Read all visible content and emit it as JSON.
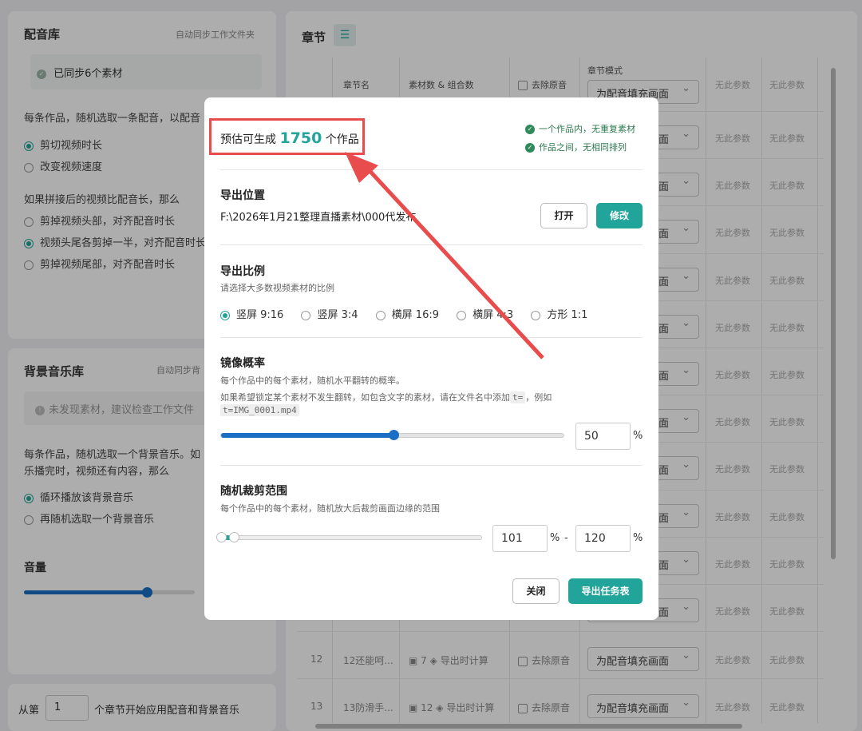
{
  "dubbing_library": {
    "title": "配音库",
    "auto_sync": "自动同步工作文件夹",
    "sync_status": "已同步6个素材",
    "desc": "每条作品，随机选取一条配音，以配音",
    "options_a": [
      "剪切视频时长",
      "改变视频速度"
    ],
    "if_longer": "如果拼接后的视频比配音长，那么",
    "options_b": [
      "剪掉视频头部，对齐配音时长",
      "视频头尾各剪掉一半，对齐配音时长",
      "剪掉视频尾部，对齐配音时长"
    ]
  },
  "bgm_library": {
    "title": "背景音乐库",
    "auto_sync": "自动同步背",
    "status": "未发现素材，建议检查工作文件",
    "desc_line1": "每条作品，随机选取一个背景音乐。如",
    "desc_line2": "乐播完时，视频还有内容，那么",
    "options": [
      "循环播放该背景音乐",
      "再随机选取一个背景音乐"
    ],
    "volume_label": "音量",
    "volume_value": 0.72
  },
  "apply_from": {
    "prefix": "从第",
    "value": "1",
    "suffix": "个章节开始应用配音和背景音乐"
  },
  "chapters": {
    "title": "章节",
    "menu_icon": "list-icon",
    "headers": {
      "name": "章节名",
      "materials": "素材数 & 组合数",
      "remove_audio": "去除原音",
      "mode": "章节模式",
      "no_param": "无此参数"
    },
    "mode_options": [
      "为配音填充画面"
    ],
    "rows": [
      {
        "index": "12",
        "name": "12还能呵...",
        "count": "7",
        "combo": "导出时计算",
        "remove": "去除原音",
        "mode": "为配音填充画面"
      },
      {
        "index": "13",
        "name": "13防滑手...",
        "count": "12",
        "combo": "导出时计算",
        "remove": "去除原音",
        "mode": "为配音填充画面"
      }
    ],
    "no_param": "无此参数"
  },
  "modal": {
    "estimate_prefix": "预估可生成",
    "estimate_count": "1750",
    "estimate_suffix": "个作品",
    "rule1": "一个作品内，无重复素材",
    "rule2": "作品之间，无相同排列",
    "export_location": {
      "title": "导出位置",
      "path": "F:\\2026年1月21整理直播素材\\000代发布",
      "open": "打开",
      "edit": "修改"
    },
    "aspect": {
      "title": "导出比例",
      "subtitle": "请选择大多数视频素材的比例",
      "options": [
        "竖屏 9:16",
        "竖屏 3:4",
        "横屏 16:9",
        "横屏 4:3",
        "方形 1:1"
      ],
      "selected": "竖屏 9:16"
    },
    "mirror": {
      "title": "镜像概率",
      "desc1": "每个作品中的每个素材，随机水平翻转的概率。",
      "desc2_prefix": "如果希望锁定某个素材不发生翻转，如包含文字的素材，请在文件名中添加",
      "code1": "t=",
      "desc2_suffix": "，例如",
      "code2": "t=IMG_0001.mp4",
      "value": "50",
      "unit": "%"
    },
    "crop": {
      "title": "随机裁剪范围",
      "desc": "每个作品中的每个素材，随机放大后裁剪画面边缘的范围",
      "min": "101",
      "max": "120",
      "unit": "%",
      "dash": "-"
    },
    "close": "关闭",
    "export": "导出任务表"
  },
  "colors": {
    "accent": "#21a59a",
    "highlight": "#e84c4c",
    "slider": "#1a6fc4"
  }
}
